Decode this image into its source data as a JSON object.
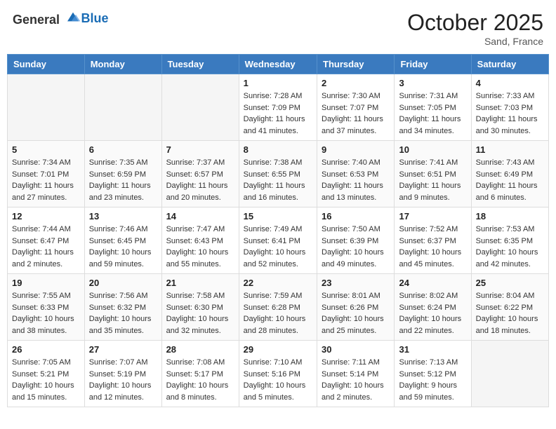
{
  "header": {
    "logo_general": "General",
    "logo_blue": "Blue",
    "month": "October 2025",
    "location": "Sand, France"
  },
  "weekdays": [
    "Sunday",
    "Monday",
    "Tuesday",
    "Wednesday",
    "Thursday",
    "Friday",
    "Saturday"
  ],
  "weeks": [
    [
      {
        "day": "",
        "info": ""
      },
      {
        "day": "",
        "info": ""
      },
      {
        "day": "",
        "info": ""
      },
      {
        "day": "1",
        "sunrise": "7:28 AM",
        "sunset": "7:09 PM",
        "daylight": "11 hours and 41 minutes."
      },
      {
        "day": "2",
        "sunrise": "7:30 AM",
        "sunset": "7:07 PM",
        "daylight": "11 hours and 37 minutes."
      },
      {
        "day": "3",
        "sunrise": "7:31 AM",
        "sunset": "7:05 PM",
        "daylight": "11 hours and 34 minutes."
      },
      {
        "day": "4",
        "sunrise": "7:33 AM",
        "sunset": "7:03 PM",
        "daylight": "11 hours and 30 minutes."
      }
    ],
    [
      {
        "day": "5",
        "sunrise": "7:34 AM",
        "sunset": "7:01 PM",
        "daylight": "11 hours and 27 minutes."
      },
      {
        "day": "6",
        "sunrise": "7:35 AM",
        "sunset": "6:59 PM",
        "daylight": "11 hours and 23 minutes."
      },
      {
        "day": "7",
        "sunrise": "7:37 AM",
        "sunset": "6:57 PM",
        "daylight": "11 hours and 20 minutes."
      },
      {
        "day": "8",
        "sunrise": "7:38 AM",
        "sunset": "6:55 PM",
        "daylight": "11 hours and 16 minutes."
      },
      {
        "day": "9",
        "sunrise": "7:40 AM",
        "sunset": "6:53 PM",
        "daylight": "11 hours and 13 minutes."
      },
      {
        "day": "10",
        "sunrise": "7:41 AM",
        "sunset": "6:51 PM",
        "daylight": "11 hours and 9 minutes."
      },
      {
        "day": "11",
        "sunrise": "7:43 AM",
        "sunset": "6:49 PM",
        "daylight": "11 hours and 6 minutes."
      }
    ],
    [
      {
        "day": "12",
        "sunrise": "7:44 AM",
        "sunset": "6:47 PM",
        "daylight": "11 hours and 2 minutes."
      },
      {
        "day": "13",
        "sunrise": "7:46 AM",
        "sunset": "6:45 PM",
        "daylight": "10 hours and 59 minutes."
      },
      {
        "day": "14",
        "sunrise": "7:47 AM",
        "sunset": "6:43 PM",
        "daylight": "10 hours and 55 minutes."
      },
      {
        "day": "15",
        "sunrise": "7:49 AM",
        "sunset": "6:41 PM",
        "daylight": "10 hours and 52 minutes."
      },
      {
        "day": "16",
        "sunrise": "7:50 AM",
        "sunset": "6:39 PM",
        "daylight": "10 hours and 49 minutes."
      },
      {
        "day": "17",
        "sunrise": "7:52 AM",
        "sunset": "6:37 PM",
        "daylight": "10 hours and 45 minutes."
      },
      {
        "day": "18",
        "sunrise": "7:53 AM",
        "sunset": "6:35 PM",
        "daylight": "10 hours and 42 minutes."
      }
    ],
    [
      {
        "day": "19",
        "sunrise": "7:55 AM",
        "sunset": "6:33 PM",
        "daylight": "10 hours and 38 minutes."
      },
      {
        "day": "20",
        "sunrise": "7:56 AM",
        "sunset": "6:32 PM",
        "daylight": "10 hours and 35 minutes."
      },
      {
        "day": "21",
        "sunrise": "7:58 AM",
        "sunset": "6:30 PM",
        "daylight": "10 hours and 32 minutes."
      },
      {
        "day": "22",
        "sunrise": "7:59 AM",
        "sunset": "6:28 PM",
        "daylight": "10 hours and 28 minutes."
      },
      {
        "day": "23",
        "sunrise": "8:01 AM",
        "sunset": "6:26 PM",
        "daylight": "10 hours and 25 minutes."
      },
      {
        "day": "24",
        "sunrise": "8:02 AM",
        "sunset": "6:24 PM",
        "daylight": "10 hours and 22 minutes."
      },
      {
        "day": "25",
        "sunrise": "8:04 AM",
        "sunset": "6:22 PM",
        "daylight": "10 hours and 18 minutes."
      }
    ],
    [
      {
        "day": "26",
        "sunrise": "7:05 AM",
        "sunset": "5:21 PM",
        "daylight": "10 hours and 15 minutes."
      },
      {
        "day": "27",
        "sunrise": "7:07 AM",
        "sunset": "5:19 PM",
        "daylight": "10 hours and 12 minutes."
      },
      {
        "day": "28",
        "sunrise": "7:08 AM",
        "sunset": "5:17 PM",
        "daylight": "10 hours and 8 minutes."
      },
      {
        "day": "29",
        "sunrise": "7:10 AM",
        "sunset": "5:16 PM",
        "daylight": "10 hours and 5 minutes."
      },
      {
        "day": "30",
        "sunrise": "7:11 AM",
        "sunset": "5:14 PM",
        "daylight": "10 hours and 2 minutes."
      },
      {
        "day": "31",
        "sunrise": "7:13 AM",
        "sunset": "5:12 PM",
        "daylight": "9 hours and 59 minutes."
      },
      {
        "day": "",
        "info": ""
      }
    ]
  ],
  "labels": {
    "sunrise_prefix": "Sunrise: ",
    "sunset_prefix": "Sunset: ",
    "daylight_prefix": "Daylight: "
  }
}
